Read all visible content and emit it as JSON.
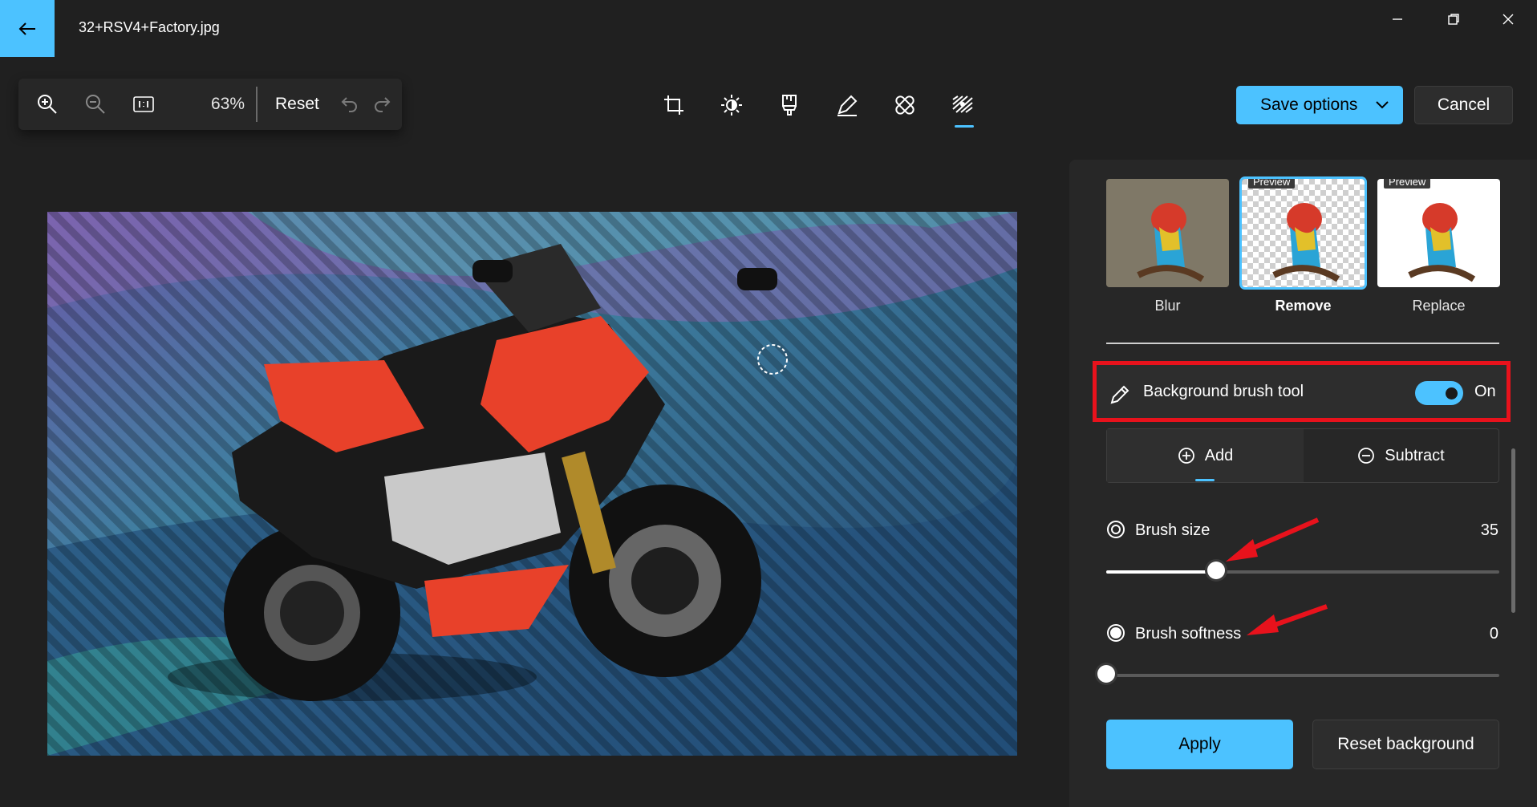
{
  "window": {
    "title": "32+RSV4+Factory.jpg"
  },
  "zoom_toolbar": {
    "zoom_level": "63%",
    "reset_label": "Reset"
  },
  "actions": {
    "save_label": "Save options",
    "cancel_label": "Cancel"
  },
  "background_options": [
    {
      "label": "Blur",
      "selected": false,
      "tag": ""
    },
    {
      "label": "Remove",
      "selected": true,
      "tag": "Preview"
    },
    {
      "label": "Replace",
      "selected": false,
      "tag": "Preview"
    }
  ],
  "brush_tool": {
    "label": "Background brush tool",
    "state": "On",
    "enabled": true
  },
  "mode": {
    "add_label": "Add",
    "subtract_label": "Subtract",
    "active": "Add"
  },
  "brush_size": {
    "label": "Brush size",
    "value": "35",
    "fraction": 0.28
  },
  "brush_softness": {
    "label": "Brush softness",
    "value": "0",
    "fraction": 0.0
  },
  "buttons": {
    "apply_label": "Apply",
    "reset_background_label": "Reset background"
  },
  "colors": {
    "accent": "#4cc2ff",
    "highlight_box": "#e8121c",
    "annotation_arrow": "#e8121c",
    "background": "#202020",
    "panel": "#272727"
  },
  "icons": {
    "toolbar": [
      "zoom-in-icon",
      "zoom-out-icon",
      "actual-size-icon",
      "undo-icon",
      "redo-icon"
    ],
    "tools": [
      "crop-icon",
      "adjustment-icon",
      "filter-icon",
      "markup-icon",
      "retouch-icon",
      "background-icon"
    ]
  }
}
